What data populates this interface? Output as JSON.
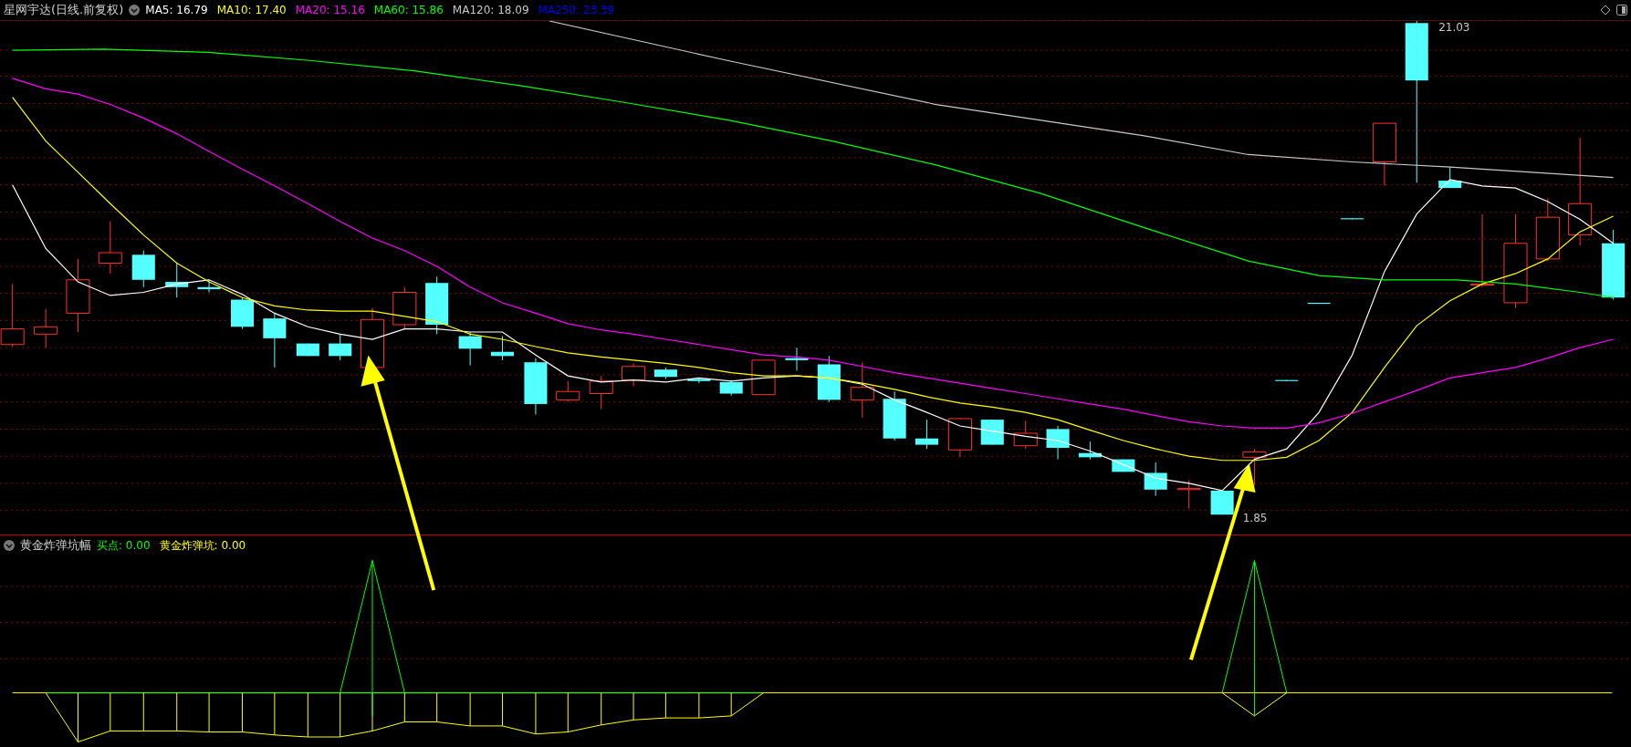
{
  "header": {
    "title": "星网宇达(日线.前复权)",
    "indicators": [
      {
        "label": "MA5: 16.79",
        "color": "#ffffff"
      },
      {
        "label": "MA10: 17.40",
        "color": "#ffff00"
      },
      {
        "label": "MA20: 15.16",
        "color": "#ff00ff"
      },
      {
        "label": "MA60: 15.86",
        "color": "#00ff00"
      },
      {
        "label": "MA120: 18.09",
        "color": "#c8c8c8"
      },
      {
        "label": "MA250: 23.39",
        "color": "#0000ff"
      }
    ]
  },
  "price_labels": {
    "high": "21.03",
    "low": "1.85"
  },
  "sub_panel": {
    "title": "黄金炸弹坑幅",
    "indicators": [
      {
        "label": "买点: 0.00",
        "color": "#00ff00"
      },
      {
        "label": "黄金炸弹坑: 0.00",
        "color": "#ffff00"
      }
    ]
  }
}
